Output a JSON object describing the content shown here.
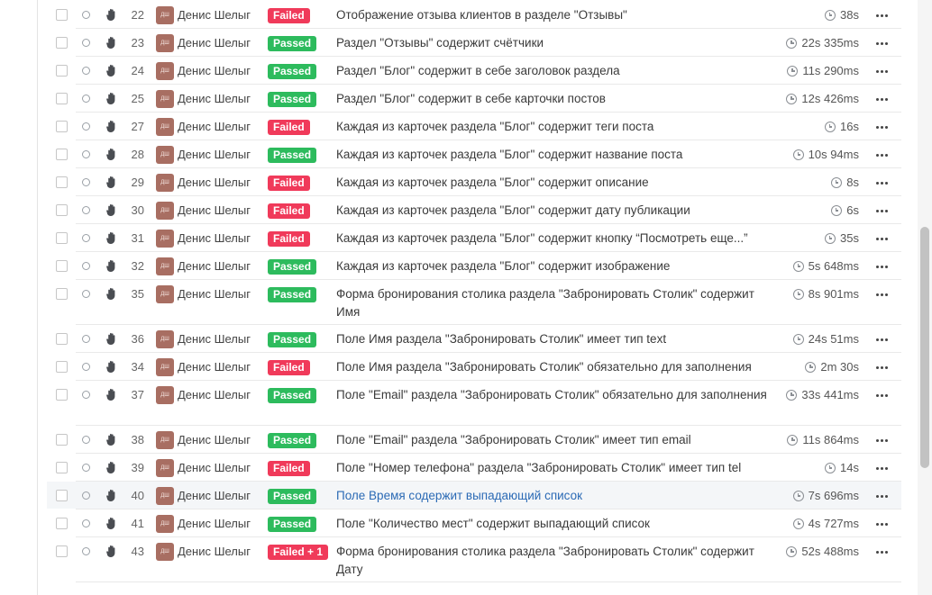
{
  "tests": [
    {
      "num": "22",
      "author": "Денис Шелыг",
      "avatar": "ДШ",
      "status": "Failed",
      "title": "Отображение отзыва клиентов в разделе \"Отзывы\"",
      "duration": "38s"
    },
    {
      "num": "23",
      "author": "Денис Шелыг",
      "avatar": "ДШ",
      "status": "Passed",
      "title": "Раздел \"Отзывы\" содержит счётчики",
      "duration": "22s 335ms"
    },
    {
      "num": "24",
      "author": "Денис Шелыг",
      "avatar": "ДШ",
      "status": "Passed",
      "title": "Раздел \"Блог\" содержит в себе заголовок раздела",
      "duration": "11s 290ms"
    },
    {
      "num": "25",
      "author": "Денис Шелыг",
      "avatar": "ДШ",
      "status": "Passed",
      "title": "Раздел \"Блог\" содержит в себе карточки постов",
      "duration": "12s 426ms"
    },
    {
      "num": "27",
      "author": "Денис Шелыг",
      "avatar": "ДШ",
      "status": "Failed",
      "title": "Каждая из карточек раздела \"Блог\" содержит теги поста",
      "duration": "16s"
    },
    {
      "num": "28",
      "author": "Денис Шелыг",
      "avatar": "ДШ",
      "status": "Passed",
      "title": "Каждая из карточек раздела \"Блог\" содержит название поста",
      "duration": "10s 94ms"
    },
    {
      "num": "29",
      "author": "Денис Шелыг",
      "avatar": "ДШ",
      "status": "Failed",
      "title": "Каждая из карточек раздела \"Блог\" содержит описание",
      "duration": "8s"
    },
    {
      "num": "30",
      "author": "Денис Шелыг",
      "avatar": "ДШ",
      "status": "Failed",
      "title": "Каждая из карточек раздела \"Блог\" содержит дату публикации",
      "duration": "6s"
    },
    {
      "num": "31",
      "author": "Денис Шелыг",
      "avatar": "ДШ",
      "status": "Failed",
      "title": "Каждая из карточек раздела \"Блог\" содержит кнопку “Посмотреть еще...”",
      "duration": "35s"
    },
    {
      "num": "32",
      "author": "Денис Шелыг",
      "avatar": "ДШ",
      "status": "Passed",
      "title": "Каждая из карточек раздела \"Блог\" содержит изображение",
      "duration": "5s 648ms"
    },
    {
      "num": "35",
      "author": "Денис Шелыг",
      "avatar": "ДШ",
      "status": "Passed",
      "title": "Форма бронирования столика раздела \"Забронировать Столик\" содержит Имя",
      "duration": "8s 901ms"
    },
    {
      "num": "36",
      "author": "Денис Шелыг",
      "avatar": "ДШ",
      "status": "Passed",
      "title": "Поле Имя раздела \"Забронировать Столик\" имеет тип text",
      "duration": "24s 51ms"
    },
    {
      "num": "34",
      "author": "Денис Шелыг",
      "avatar": "ДШ",
      "status": "Failed",
      "title": "Поле Имя раздела \"Забронировать Столик\" обязательно для заполнения",
      "duration": "2m 30s"
    },
    {
      "num": "37",
      "author": "Денис Шелыг",
      "avatar": "ДШ",
      "status": "Passed",
      "title": "Поле \"Email\" раздела \"Забронировать Столик\" обязательно для заполнения",
      "duration": "33s 441ms"
    },
    {
      "num": "38",
      "author": "Денис Шелыг",
      "avatar": "ДШ",
      "status": "Passed",
      "title": "Поле \"Email\" раздела \"Забронировать Столик\" имеет тип email",
      "duration": "11s 864ms"
    },
    {
      "num": "39",
      "author": "Денис Шелыг",
      "avatar": "ДШ",
      "status": "Failed",
      "title": "Поле \"Номер телефона\" раздела \"Забронировать Столик\" имеет тип tel",
      "duration": "14s"
    },
    {
      "num": "40",
      "author": "Денис Шелыг",
      "avatar": "ДШ",
      "status": "Passed",
      "title": "Поле Время содержит выпадающий список",
      "duration": "7s 696ms",
      "highlighted": true
    },
    {
      "num": "41",
      "author": "Денис Шелыг",
      "avatar": "ДШ",
      "status": "Passed",
      "title": "Поле \"Количество мест\" содержит выпадающий список",
      "duration": "4s 727ms"
    },
    {
      "num": "43",
      "author": "Денис Шелыг",
      "avatar": "ДШ",
      "status": "Failed + 1",
      "title": "Форма бронирования столика раздела \"Забронировать Столик\" содержит Дату",
      "duration": "52s 488ms"
    }
  ],
  "colors": {
    "passed": "#2dbb5d",
    "failed": "#f03a5a",
    "avatar": "#a86e62",
    "link": "#2b6ab5"
  },
  "icons": {
    "checkbox": "checkbox-icon",
    "status": "circle-icon",
    "manual": "hand-icon",
    "duration": "clock-icon",
    "actions": "more-dots-icon"
  }
}
